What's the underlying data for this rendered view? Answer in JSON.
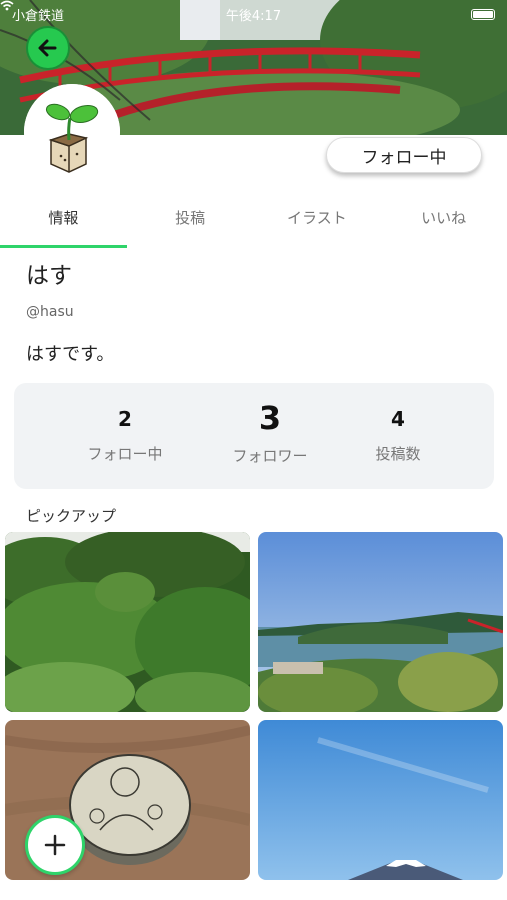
{
  "status_bar": {
    "carrier": "小倉鉄道",
    "time": "午後4:17"
  },
  "profile": {
    "follow_button_label": "フォロー中",
    "name": "はす",
    "handle": "@hasu",
    "bio": "はすです。"
  },
  "tabs": [
    {
      "label": "情報",
      "active": true
    },
    {
      "label": "投稿",
      "active": false
    },
    {
      "label": "イラスト",
      "active": false
    },
    {
      "label": "いいね",
      "active": false
    }
  ],
  "stats": {
    "following": {
      "value": "2",
      "label": "フォロー中"
    },
    "followers": {
      "value": "3",
      "label": "フォロワー"
    },
    "posts": {
      "value": "4",
      "label": "投稿数"
    }
  },
  "pickup": {
    "title": "ピックアップ",
    "items": [
      {
        "icon": "forest-photo"
      },
      {
        "icon": "bay-landscape-photo"
      },
      {
        "icon": "buddha-jar-photo"
      },
      {
        "icon": "mount-fuji-photo"
      }
    ]
  },
  "accent_color": "#2fd46a",
  "fab_icon": "plus-icon",
  "back_icon": "arrow-left-icon"
}
